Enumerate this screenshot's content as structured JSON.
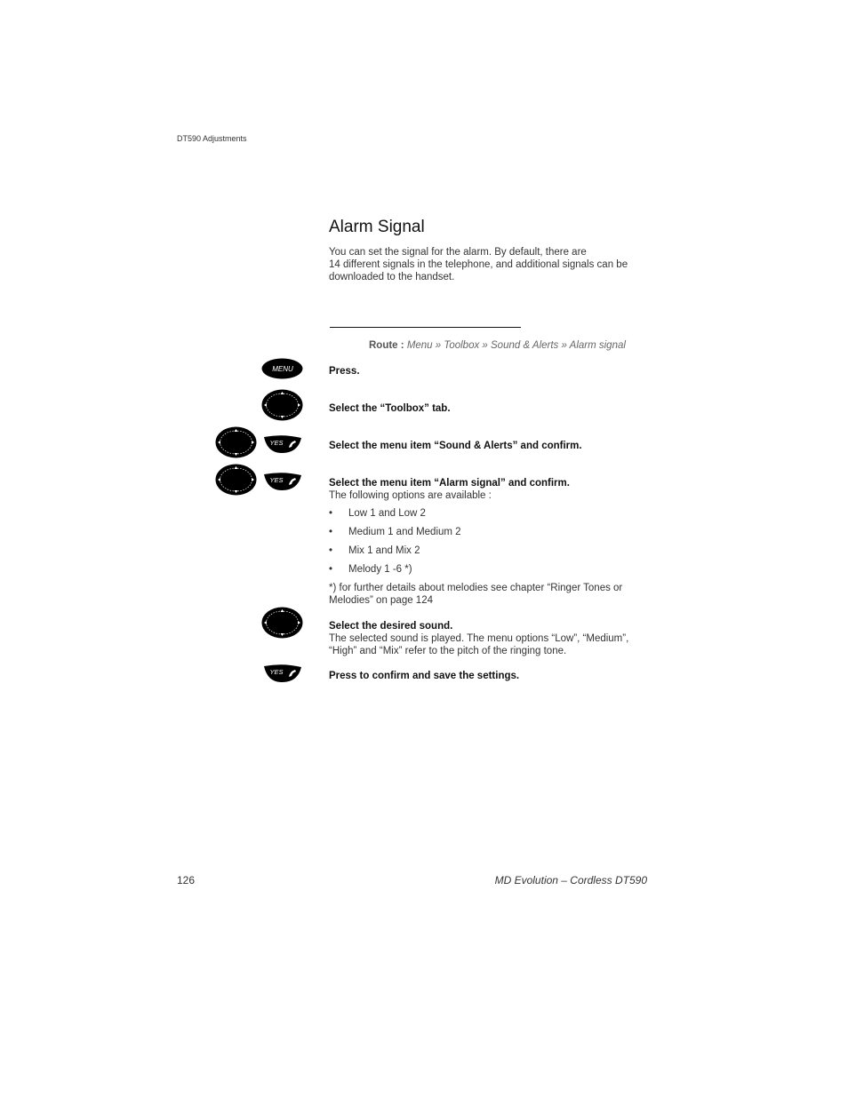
{
  "header": {
    "running_title": "DT590 Adjustments"
  },
  "section": {
    "title": "Alarm Signal",
    "intro_lines": [
      "You can set the signal for the alarm. By default, there are",
      "14 different signals in the telephone, and additional signals can be",
      "downloaded to the handset."
    ]
  },
  "route": {
    "label": "Route :",
    "path": "Menu » Toolbox » Sound & Alerts » Alarm signal"
  },
  "keys": {
    "menu_label": "MENU",
    "yes_label": "YES"
  },
  "steps": [
    {
      "keys": [
        "menu-key"
      ],
      "bold": "Press."
    },
    {
      "keys": [
        "nav-key"
      ],
      "bold": "Select the “Toolbox” tab."
    },
    {
      "keys": [
        "nav-key",
        "yes-key"
      ],
      "bold": "Select the menu item “Sound & Alerts” and confirm."
    },
    {
      "keys": [
        "nav-key",
        "yes-key"
      ],
      "bold": "Select the menu item “Alarm signal” and confirm.",
      "text": "The following options are available :",
      "options": [
        "Low 1 and Low 2",
        "Medium 1 and Medium 2",
        "Mix 1 and Mix 2",
        "Melody 1 -6 *)"
      ],
      "note_lines": [
        "*) for further details about melodies see chapter “Ringer Tones or",
        "Melodies” on page 124"
      ]
    },
    {
      "keys": [
        "nav-key"
      ],
      "bold": "Select the desired sound.",
      "text_lines": [
        "The selected sound is played. The menu options “Low”, “Medium”,",
        "“High” and “Mix” refer to the pitch of the ringing tone."
      ]
    },
    {
      "keys": [
        "yes-key"
      ],
      "bold": "Press to confirm and save the settings."
    }
  ],
  "footer": {
    "page_number": "126",
    "product": "MD Evolution – Cordless DT590"
  }
}
